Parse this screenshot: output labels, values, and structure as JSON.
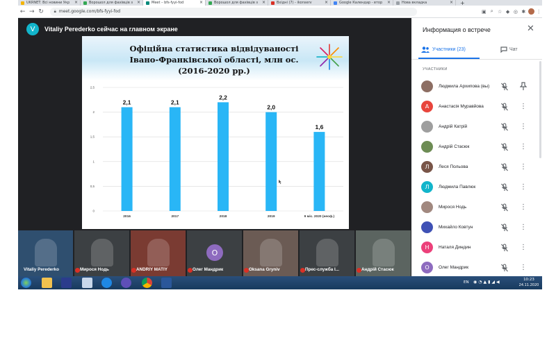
{
  "browser": {
    "tabs": [
      {
        "label": "UKRNET: Всі новини Укр",
        "color": "#f4b400"
      },
      {
        "label": "Ворошол для фахівців з",
        "color": "#34a853"
      },
      {
        "label": "Meet – bfs-fyyi-fod",
        "color": "#00897b"
      },
      {
        "label": "Ворошол для фахівців з",
        "color": "#34a853"
      },
      {
        "label": "Вхідні (7) - ikonserv",
        "color": "#d93025"
      },
      {
        "label": "Google Календар - втор",
        "color": "#4285f4"
      },
      {
        "label": "Нова вкладка",
        "color": "#9aa0a6"
      }
    ],
    "url": "meet.google.com/bfs-fyyi-fod"
  },
  "meet": {
    "presenter_initial": "V",
    "presenter_caption": "Vitaliy Perederko сейчас на главном экране"
  },
  "slide": {
    "title_lines": [
      "Офіційна статистика відвідуваності",
      "Івано-Франківської області, млн ос.",
      "(2016-2020 рр.)"
    ]
  },
  "chart_data": {
    "type": "bar",
    "categories": [
      "2016",
      "2017",
      "2018",
      "2019",
      "9 міс. 2020 (неоф.)"
    ],
    "values": [
      2.1,
      2.1,
      2.2,
      2.0,
      1.6
    ],
    "data_labels": [
      "2,1",
      "2,1",
      "2,2",
      "2,0",
      "1,6"
    ],
    "yticks": [
      "0",
      "0,5",
      "1",
      "1,5",
      "2",
      "2,5"
    ],
    "ylim": [
      0,
      2.5
    ],
    "grid": true,
    "legend": false,
    "bar_color": "#29b6f6"
  },
  "panel": {
    "title": "Информация о встрече",
    "tab_people": "Участники (23)",
    "tab_chat": "Чат",
    "section_label": "УЧАСТНИКИ",
    "participants": [
      {
        "name": "Людмила Архипова (вы)",
        "initial": "",
        "color": "#8d6e63",
        "action": "pin"
      },
      {
        "name": "Анастасія Муравйова",
        "initial": "А",
        "color": "#e8453c",
        "action": "more"
      },
      {
        "name": "Андрій Катрій",
        "initial": "",
        "color": "#9e9e9e",
        "action": "more"
      },
      {
        "name": "Андрій Стасюк",
        "initial": "",
        "color": "#6d8c54",
        "action": "more"
      },
      {
        "name": "Леся Польова",
        "initial": "Л",
        "color": "#795548",
        "action": "more"
      },
      {
        "name": "Людмила Павлюк",
        "initial": "Л",
        "color": "#12b5cb",
        "action": "more"
      },
      {
        "name": "Мирося Нодь",
        "initial": "",
        "color": "#a1887f",
        "action": "more"
      },
      {
        "name": "Михайло Ковтун",
        "initial": "",
        "color": "#3f51b5",
        "action": "more"
      },
      {
        "name": "Наталя Диндин",
        "initial": "Н",
        "color": "#ec407a",
        "action": "more"
      },
      {
        "name": "Олег Мандрик",
        "initial": "О",
        "color": "#8e6bbf",
        "action": "more"
      }
    ]
  },
  "tiles": [
    {
      "name": "Vitaliy Perederko",
      "muted": false,
      "initial": "",
      "color": "#2f4f6f"
    },
    {
      "name": "Мирося Нодь",
      "muted": true,
      "initial": "",
      "color": "#3c4043"
    },
    {
      "name": "ANDRIY MATIY",
      "muted": true,
      "initial": "",
      "color": "#7a3b32"
    },
    {
      "name": "Олег Мандрик",
      "muted": true,
      "initial": "О",
      "color": "#3c4043"
    },
    {
      "name": "Oksana Gryniv",
      "muted": true,
      "initial": "",
      "color": "#6b5b54"
    },
    {
      "name": "Прес-служба І...",
      "muted": true,
      "initial": "",
      "color": "#3c4043"
    },
    {
      "name": "Андрій Стасюк",
      "muted": true,
      "initial": "",
      "color": "#5b6460"
    }
  ],
  "taskbar": {
    "lang": "EN",
    "time": "10:23",
    "date": "24.11.2020"
  }
}
